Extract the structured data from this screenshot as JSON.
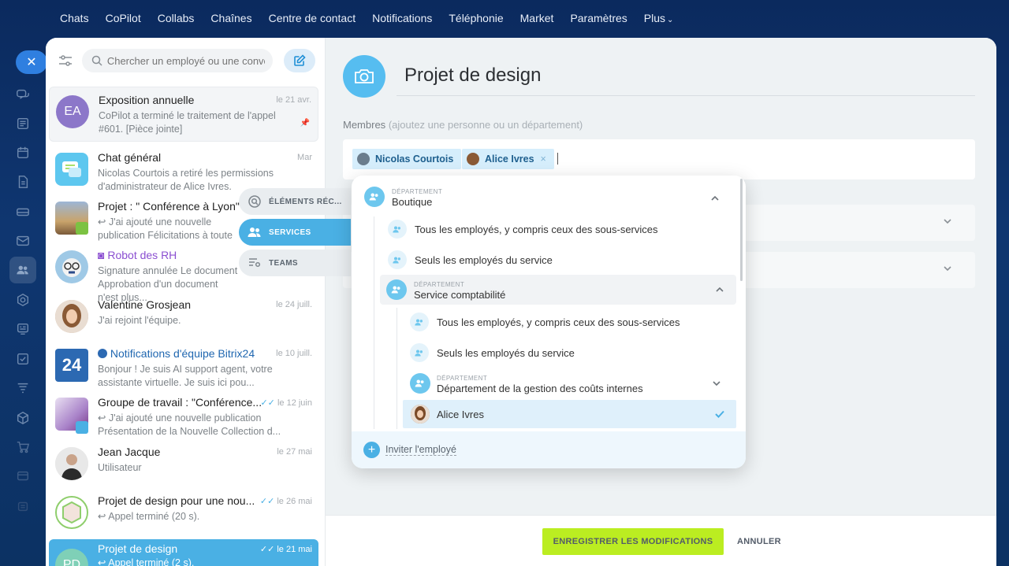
{
  "nav": [
    "Chats",
    "CoPilot",
    "Collabs",
    "Chaînes",
    "Centre de contact",
    "Notifications",
    "Téléphonie",
    "Market",
    "Paramètres",
    "Plus"
  ],
  "nav_more_icon": "chevron-down-icon",
  "search": {
    "placeholder": "Chercher un employé ou une conve"
  },
  "chats": [
    {
      "initials": "EA",
      "title": "Exposition annuelle",
      "date": "le 21 avr.",
      "msg": "CoPilot a terminé le traitement de l'appel #601. [Pièce jointe]",
      "pinned": true
    },
    {
      "title": "Chat général",
      "date": "Mar",
      "msg": "Nicolas Courtois a retiré les permissions d'administrateur de Alice Ivres."
    },
    {
      "title": "Projet : \" Conférence à Lyon\"",
      "date": "",
      "msg": "↩ J'ai ajouté une nouvelle publication Félicitations à toute l'équipe po"
    },
    {
      "title": "Robot des RH",
      "date": "",
      "msg": "Signature annulée Le document Approbation d'un document n'est plus..."
    },
    {
      "title": "Valentine Grosjean",
      "date": "le 24 juill.",
      "msg": "J'ai rejoint l'équipe."
    },
    {
      "initials": "24",
      "title": "Notifications d'équipe Bitrix24",
      "date": "le 10 juill.",
      "msg": "Bonjour ! Je suis AI support agent, votre assistante virtuelle. Je suis ici pou..."
    },
    {
      "title": "Groupe de travail : \"Conférence...",
      "date": "le 12 juin",
      "msg": "↩ J'ai ajouté une nouvelle publication Présentation de la Nouvelle Collection d..."
    },
    {
      "title": "Jean Jacque",
      "date": "le 27 mai",
      "msg": "Utilisateur"
    },
    {
      "title": "Projet de design pour une nou...",
      "date": "le 26 mai",
      "msg": "↩ Appel terminé (20 s)."
    },
    {
      "initials": "PD",
      "title": "Projet de design",
      "date": "le 21 mai",
      "msg": "↩ Appel terminé (2 s)."
    }
  ],
  "tabs": [
    {
      "label": "ÉLÉMENTS RÉC...",
      "icon": "search-list-icon"
    },
    {
      "label": "SERVICES",
      "icon": "users-icon",
      "active": true
    },
    {
      "label": "TEAMS",
      "icon": "teams-icon"
    }
  ],
  "editor": {
    "title": "Projet de design",
    "members_label": "Membres",
    "members_hint": "(ajoutez une personne ou un département)",
    "chips": [
      "Nicolas Courtois",
      "Alice Ivres"
    ],
    "chip_remove": "×"
  },
  "popup": {
    "dept_label": "DÉPARTEMENT",
    "dept1": "Boutique",
    "opt_all": "Tous les employés, y compris ceux des sous-services",
    "opt_only": "Seuls les employés du service",
    "dept2": "Service comptabilité",
    "dept3": "Département de la gestion des coûts internes",
    "selected_person": "Alice Ivres",
    "invite": "Inviter l'employé"
  },
  "buttons": {
    "save": "ENREGISTRER LES MODIFICATIONS",
    "cancel": "ANNULER"
  },
  "colors": {
    "accent": "#4ab0e4",
    "save": "#bbed21",
    "nav_bg": "#0f3670"
  }
}
